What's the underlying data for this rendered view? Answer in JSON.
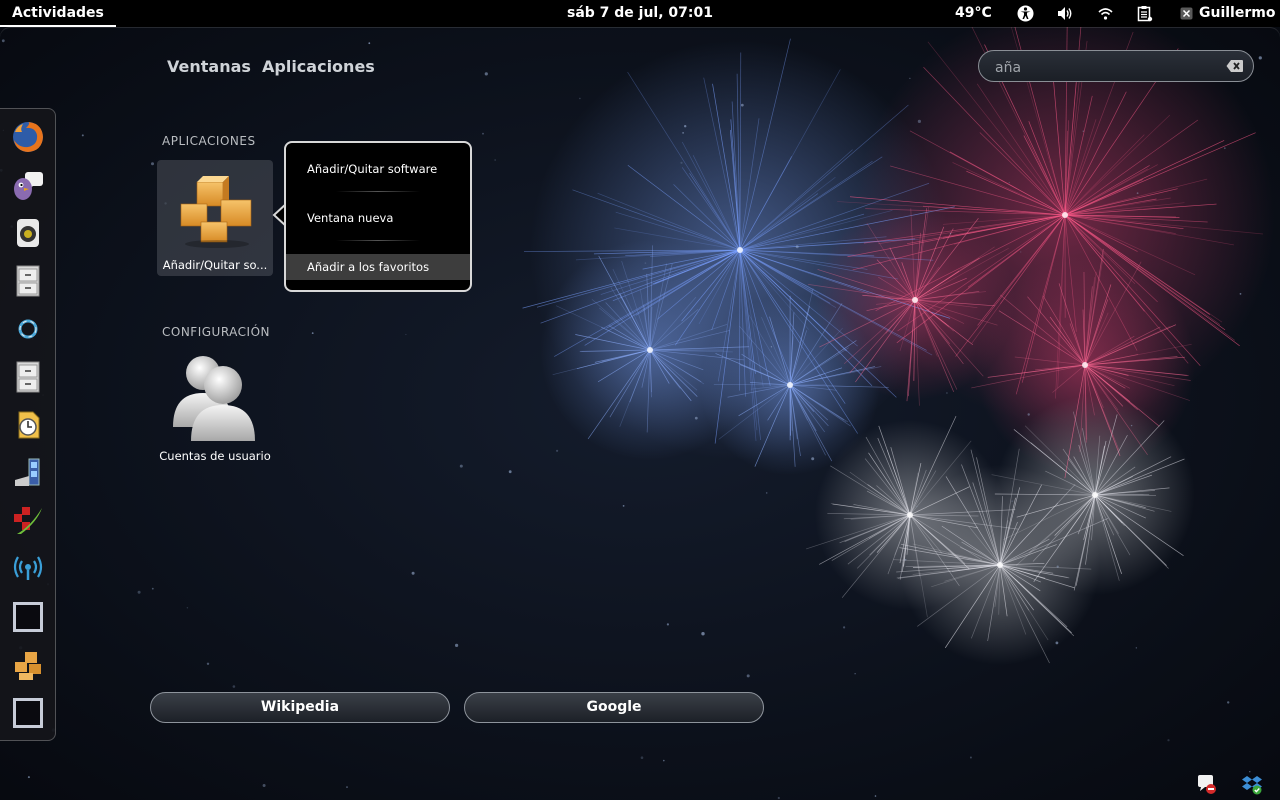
{
  "top_panel": {
    "activities_label": "Actividades",
    "clock": "sáb  7 de jul, 07:01",
    "temperature": "49°C",
    "user_name": "Guillermo",
    "tray_icons": [
      "accessibility-icon",
      "volume-icon",
      "wifi-icon",
      "clipboard-icon",
      "user-status-icon"
    ]
  },
  "view_selector": {
    "tabs": [
      {
        "label": "Ventanas"
      },
      {
        "label": "Aplicaciones"
      }
    ]
  },
  "search": {
    "value": "aña",
    "clear_icon": "clear-icon"
  },
  "dash": {
    "items": [
      {
        "icon": "firefox-icon"
      },
      {
        "icon": "pidgin-icon"
      },
      {
        "icon": "rhythmbox-icon"
      },
      {
        "icon": "file-cabinet-icon"
      },
      {
        "icon": "ring-icon"
      },
      {
        "icon": "file-cabinet-icon"
      },
      {
        "icon": "clock-app-icon"
      },
      {
        "icon": "media-app-icon"
      },
      {
        "icon": "quill-app-icon"
      },
      {
        "icon": "wireless-icon"
      },
      {
        "icon": "window-frame-icon"
      },
      {
        "icon": "packages-icon"
      },
      {
        "icon": "window-frame-icon"
      }
    ]
  },
  "results": {
    "sections": [
      {
        "heading": "APLICACIONES",
        "items": [
          {
            "label": "Añadir/Quitar so...",
            "icon": "packages-icon"
          }
        ]
      },
      {
        "heading": "CONFIGURACIÓN",
        "items": [
          {
            "label": "Cuentas de usuario",
            "icon": "users-icon"
          }
        ]
      }
    ]
  },
  "context_menu": {
    "items": [
      {
        "label": "Añadir/Quitar software"
      },
      {
        "label": "Ventana nueva"
      },
      {
        "label": "Añadir a los favoritos"
      }
    ]
  },
  "search_providers": [
    {
      "label": "Wikipedia"
    },
    {
      "label": "Google"
    }
  ],
  "message_tray": {
    "icons": [
      "chat-busy-icon",
      "dropbox-icon"
    ]
  },
  "colors": {
    "panel": "#000000",
    "background": "#0b1019",
    "menu_highlight": "#3d3d3d"
  }
}
